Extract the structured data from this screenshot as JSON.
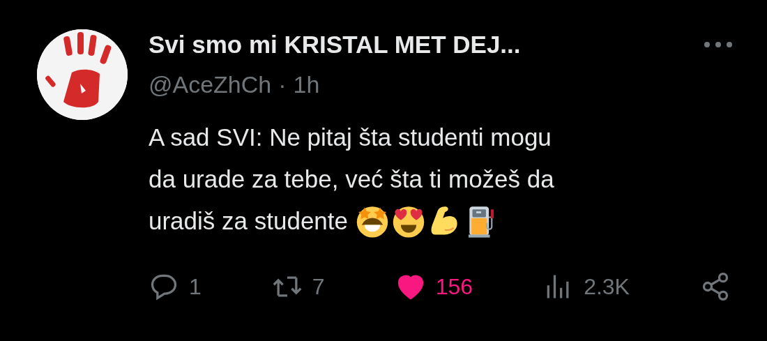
{
  "author": {
    "name": "Svi smo mi KRISTAL MET DEJ...",
    "handle": "@AceZhCh",
    "separator": "·",
    "time": "1h"
  },
  "text_lines": [
    "A sad SVI: Ne pitaj šta studenti mogu",
    "da urade za tebe, već šta ti možeš da",
    "uradiš za studente"
  ],
  "actions": [
    {
      "kind": "reply",
      "count": "1"
    },
    {
      "kind": "repost",
      "count": "7"
    },
    {
      "kind": "like",
      "count": "156",
      "liked": true
    },
    {
      "kind": "views",
      "count": "2.3K"
    },
    {
      "kind": "share"
    }
  ]
}
